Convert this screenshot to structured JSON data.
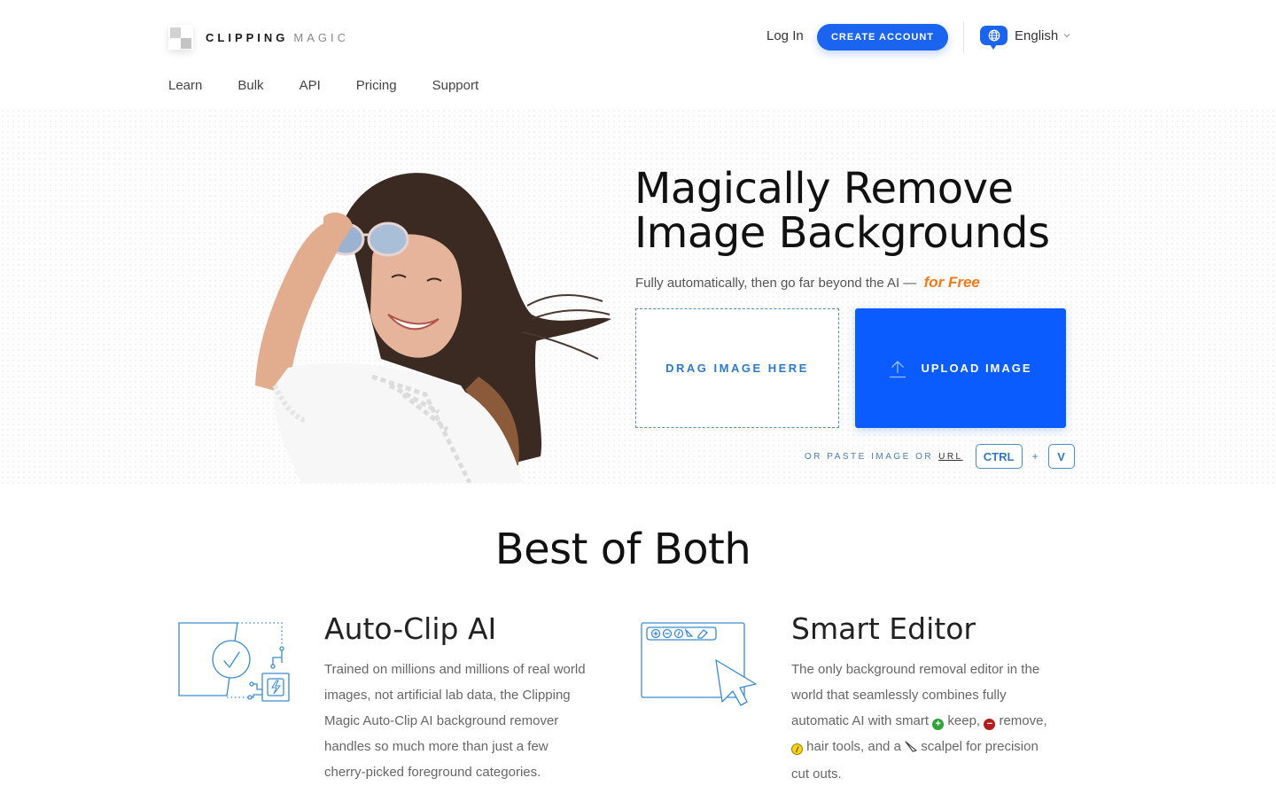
{
  "header": {
    "logo": {
      "bold": "CLIPPING",
      "light": "MAGIC"
    },
    "login_label": "Log In",
    "create_account_label": "CREATE ACCOUNT",
    "language": {
      "icon": "globe-icon",
      "label": "English",
      "caret": "⌄"
    }
  },
  "nav": {
    "items": [
      {
        "label": "Learn"
      },
      {
        "label": "Bulk"
      },
      {
        "label": "API"
      },
      {
        "label": "Pricing"
      },
      {
        "label": "Support"
      }
    ]
  },
  "hero": {
    "title_line1": "Magically Remove",
    "title_line2": "Image Backgrounds",
    "subtitle": "Fully automatically, then go far beyond the AI —",
    "subtitle_highlight": "for Free",
    "drag_label": "DRAG IMAGE HERE",
    "upload_label": "UPLOAD IMAGE",
    "paste_text": "OR PASTE IMAGE OR",
    "paste_url": "URL",
    "key_ctrl": "CTRL",
    "key_plus": "+",
    "key_v": "V",
    "photo_alt": "Smiling woman holding sunglasses on her head"
  },
  "section": {
    "title": "Best of Both"
  },
  "features": [
    {
      "title": "Auto-Clip AI",
      "icon": "auto-clip-ai-icon",
      "body": "Trained on millions and millions of real world images, not artificial lab data, the Clipping Magic Auto-Clip AI background remover handles so much more than just a few cherry-picked foreground categories."
    },
    {
      "title": "Smart Editor",
      "icon": "smart-editor-icon",
      "body_part1": "The only background removal editor in the world that seamlessly combines fully automatic AI with smart",
      "body_keep": "keep,",
      "body_remove": "remove,",
      "body_hair": "hair tools, and a",
      "body_scalpel": "scalpel for precision cut outs."
    }
  ],
  "colors": {
    "brand_blue": "#1a64f0",
    "upload_blue": "#0a5cff",
    "highlight_orange": "#f07a1a",
    "keep_green": "#2ea43a",
    "remove_red": "#b51c1c",
    "hair_yellow": "#f2d21a"
  }
}
